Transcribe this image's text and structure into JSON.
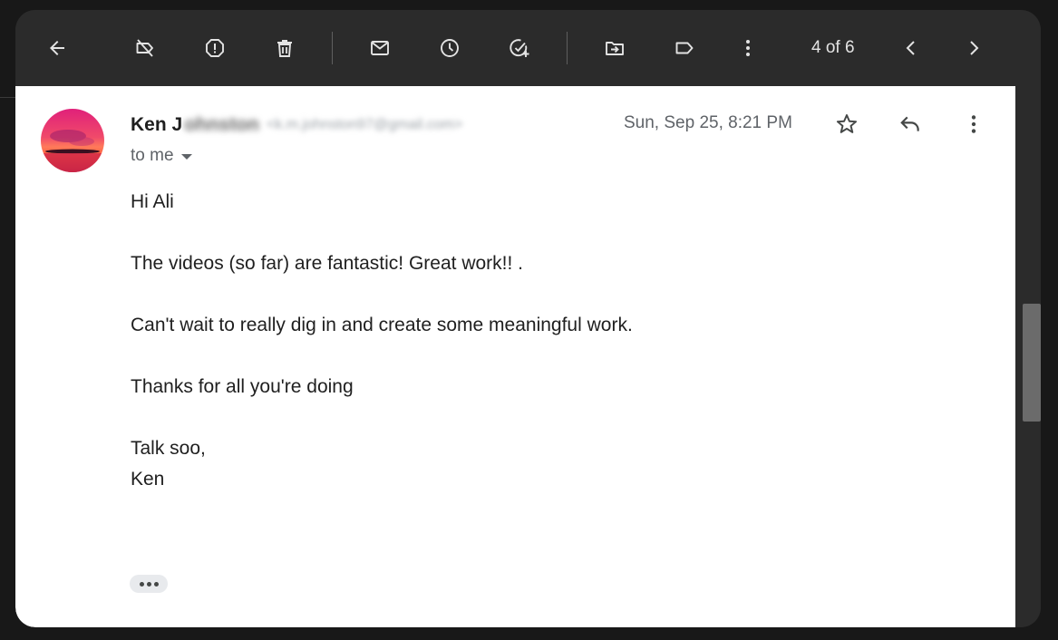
{
  "toolbar": {
    "pager": "4 of 6",
    "icons": [
      "back-arrow-icon",
      "label-off-icon",
      "report-spam-icon",
      "trash-icon",
      "mark-unread-icon",
      "snooze-clock-icon",
      "add-task-icon",
      "move-to-icon",
      "label-icon",
      "more-vertical-icon",
      "chevron-left-icon",
      "chevron-right-icon"
    ]
  },
  "message": {
    "sender_name": "Ken J",
    "sender_name_blurred": "ohnston",
    "sender_email_blurred": "<k.m.johnston97@gmail.com>",
    "recipient": "to me",
    "date": "Sun, Sep 25, 8:21 PM",
    "body": {
      "greeting": "Hi Ali",
      "line1": "The videos (so far) are fantastic! Great work!! .",
      "line2": "Can't wait to really dig in and create some meaningful work.",
      "line3": "Thanks for all you're doing",
      "signoff": "Talk soo,",
      "signature": "Ken"
    }
  },
  "colors": {
    "toolbar_bg": "#2b2b2b",
    "icon_light": "#e3e3e3",
    "content_bg": "#ffffff",
    "text_primary": "#1f1f1f",
    "text_secondary": "#5f6368"
  }
}
